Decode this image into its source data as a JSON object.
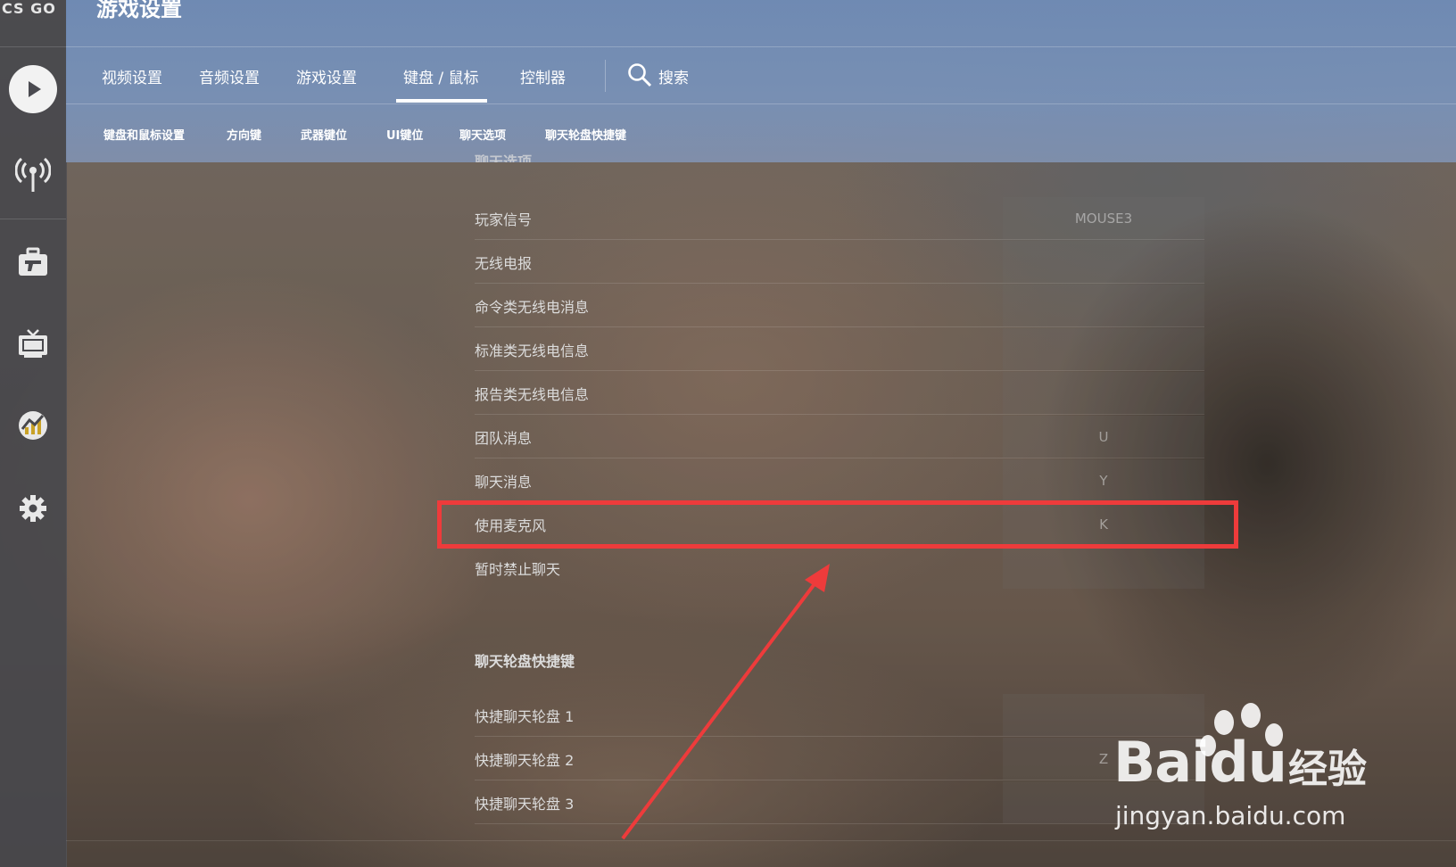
{
  "app": {
    "logo_text": "CS GO",
    "title": "游戏设置"
  },
  "sidebar": {
    "items": [
      {
        "icon": "play-icon"
      },
      {
        "icon": "broadcast-icon"
      },
      {
        "icon": "inventory-briefcase-icon"
      },
      {
        "icon": "tv-icon"
      },
      {
        "icon": "stats-icon"
      },
      {
        "icon": "gear-icon"
      }
    ]
  },
  "tabs": [
    {
      "label": "视频设置"
    },
    {
      "label": "音频设置"
    },
    {
      "label": "游戏设置"
    },
    {
      "label": "键盘 / 鼠标",
      "active": true
    },
    {
      "label": "控制器"
    }
  ],
  "search": {
    "label": "搜索"
  },
  "subtabs": [
    {
      "label": "键盘和鼠标设置"
    },
    {
      "label": "方向键"
    },
    {
      "label": "武器键位"
    },
    {
      "label": "UI键位"
    },
    {
      "label": "聊天选项"
    },
    {
      "label": "聊天轮盘快捷键"
    }
  ],
  "sections": [
    {
      "header": "聊天选项",
      "rows": [
        {
          "label": "玩家信号",
          "key": "MOUSE3"
        },
        {
          "label": "无线电报",
          "key": ""
        },
        {
          "label": "命令类无线电消息",
          "key": ""
        },
        {
          "label": "标准类无线电信息",
          "key": ""
        },
        {
          "label": "报告类无线电信息",
          "key": ""
        },
        {
          "label": "团队消息",
          "key": "U"
        },
        {
          "label": "聊天消息",
          "key": "Y"
        },
        {
          "label": "使用麦克风",
          "key": "K",
          "highlighted": true
        },
        {
          "label": "暂时禁止聊天",
          "key": ""
        }
      ]
    },
    {
      "header": "聊天轮盘快捷键",
      "rows": [
        {
          "label": "快捷聊天轮盘 1",
          "key": ""
        },
        {
          "label": "快捷聊天轮盘 2",
          "key": "Z"
        },
        {
          "label": "快捷聊天轮盘 3",
          "key": ""
        }
      ]
    }
  ],
  "annotation": {
    "color": "#ee3b3b"
  },
  "watermark": {
    "brand": "Bai",
    "brand_du": "du",
    "brand_cn": "经验",
    "url": "jingyan.baidu.com"
  }
}
